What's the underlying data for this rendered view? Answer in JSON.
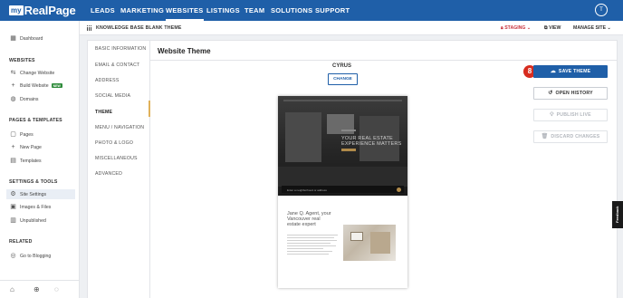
{
  "brand": {
    "logo_prefix": "my",
    "logo_name": "RealPage"
  },
  "topnav": {
    "items": [
      "LEADS",
      "MARKETING",
      "WEBSITES",
      "LISTINGS",
      "TEAM",
      "SOLUTIONS",
      "SUPPORT"
    ],
    "active": "WEBSITES",
    "avatar_initial": "T"
  },
  "sidebar": {
    "dashboard": "Dashboard",
    "websites_heading": "WEBSITES",
    "websites": [
      "Change Website",
      "Build Website",
      "Domains"
    ],
    "new_badge": "NEW",
    "pages_heading": "PAGES & TEMPLATES",
    "pages": [
      "Pages",
      "New Page",
      "Templates"
    ],
    "settings_heading": "SETTINGS & TOOLS",
    "settings": [
      "Site Settings",
      "Images & Files",
      "Unpublished"
    ],
    "related_heading": "RELATED",
    "related": [
      "Go to Blogging"
    ],
    "bottom_icons": [
      "home-icon",
      "help-icon",
      "chat-icon"
    ]
  },
  "subheader": {
    "site_name": "KNOWLEDGE BASE BLANK THEME",
    "staging": "STAGING",
    "view": "VIEW",
    "manage_site": "MANAGE SITE"
  },
  "settings_nav": {
    "items": [
      "BASIC INFORMATION",
      "EMAIL & CONTACT",
      "ADDRESS",
      "SOCIAL MEDIA",
      "THEME",
      "MENU / NAVIGATION",
      "PHOTO & LOGO",
      "MISCELLANEOUS",
      "ADVANCED"
    ],
    "active": "THEME"
  },
  "main": {
    "title": "Website Theme",
    "theme_name": "CYRUS",
    "change_label": "CHANGE",
    "preview": {
      "hero_text_line1": "YOUR REAL ESTATE",
      "hero_text_line2": "EXPERIENCE MATTERS",
      "search_placeholder": "Enter a neighborhood or address",
      "agent_line1": "Jane Q. Agent, your",
      "agent_line2": "Vancouver real",
      "agent_line3": "estate expert"
    }
  },
  "actions": {
    "step_marker": "8",
    "save_theme": "SAVE THEME",
    "open_history": "OPEN HISTORY",
    "publish_live": "PUBLISH LIVE",
    "discard_changes": "DISCARD CHANGES"
  },
  "feedback_label": "Feedback",
  "colors": {
    "brand_blue": "#1f5fa8",
    "staging_red": "#c8343e",
    "marker_red": "#d72c1f",
    "active_marker": "#e0b15a"
  }
}
